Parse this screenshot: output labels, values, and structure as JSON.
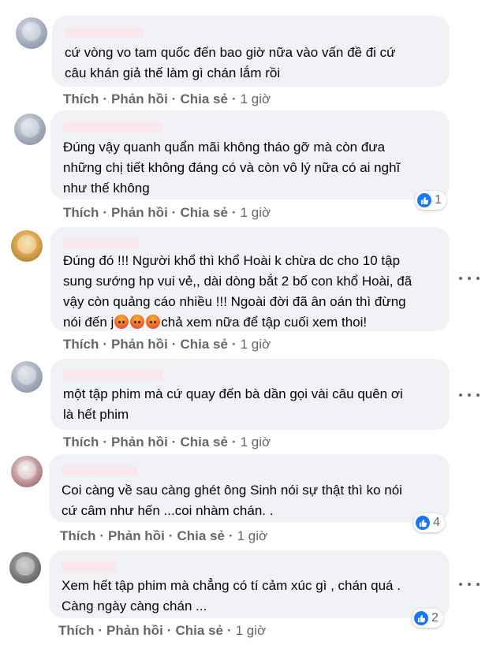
{
  "actions": {
    "like": "Thích",
    "reply": "Phản hồi",
    "share": "Chia sẻ",
    "time": "1 giờ"
  },
  "comments": [
    {
      "text": "cứ vòng vo tam quốc đến bao giờ nữa vào vấn đề đi cứ\ncâu khán giả thế làm gì chán lắm rồi"
    },
    {
      "text": "Đúng vậy quanh quẩn mãi không tháo gỡ mà còn đưa\nnhững chị tiết không đáng có và còn vô lý nữa có ai nghĩ\nnhư thế không",
      "likes": "1"
    },
    {
      "text_a": "Đúng đó !!! Người khổ thì khổ Hoài k chừa dc cho 10 tập\nsung sướng hp vui vẻ,, dài dòng bắt 2 bố con khổ Hoài, đã\nvậy còn quảng cáo nhiều !!! Ngoài đời đã ân oán thì đừng\nnói đến j",
      "text_b": "chả xem nữa để tập cuối xem thoi!",
      "emoji": "angry-emoji"
    },
    {
      "text": "một tập phim mà cứ quay đến bà dần gọi vài câu quên ơi\nlà hết phim"
    },
    {
      "text": "Coi càng về sau càng ghét ông Sinh nói sự thật thì ko nói\ncứ câm như hến ...coi nhàm chán. .",
      "likes": "4"
    },
    {
      "text": "Xem hết tập phim mà chẳng có tí cảm xúc gì , chán quá .\nCàng ngày càng chán ...",
      "likes": "2"
    }
  ],
  "colors": {
    "bubble": "#f0f2f5",
    "action": "#65676b",
    "like_blue": "#1877f2"
  }
}
